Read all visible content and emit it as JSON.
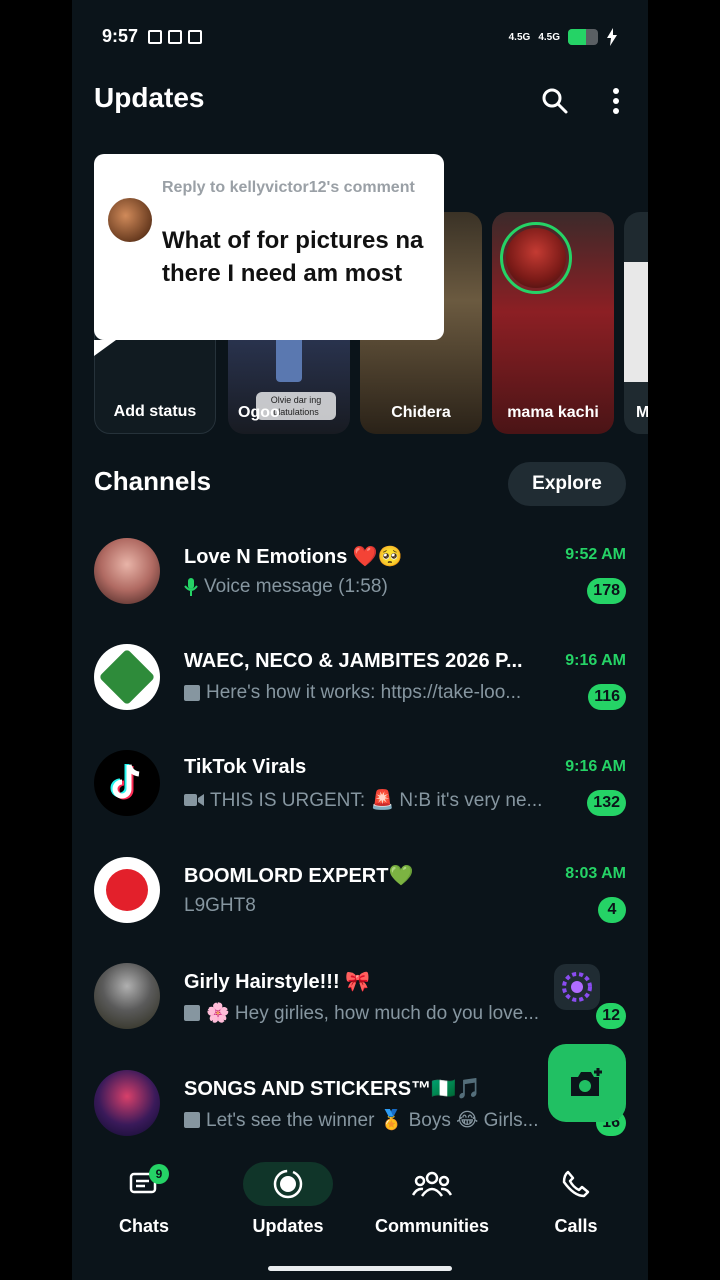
{
  "status_bar": {
    "time": "9:57",
    "network_1": "4.5G",
    "network_2": "4.5G",
    "battery_level": 0.6
  },
  "header": {
    "title": "Updates",
    "search_icon": "search-icon",
    "menu_icon": "more-vert-icon"
  },
  "popup": {
    "subtitle": "Reply to kellyvictor12's comment",
    "text": "What of for pictures na there I need am most"
  },
  "statuses": [
    {
      "label": "Add status"
    },
    {
      "label": "Ogoo",
      "overlay": "Olvie dar ing\nulatulations"
    },
    {
      "label": "Chidera"
    },
    {
      "label": "mama kachi"
    },
    {
      "label": "M"
    }
  ],
  "channels_section": {
    "title": "Channels",
    "explore_label": "Explore"
  },
  "channels": [
    {
      "name": "Love N Emotions ❤️🥺",
      "time": "9:52 AM",
      "preview_icon": "mic-icon",
      "preview": "Voice message (1:58)",
      "unread": "178"
    },
    {
      "name": "WAEC, NECO & JAMBITES 2026 P...",
      "time": "9:16 AM",
      "preview_icon": "image-icon",
      "preview": "Here's how it works: https://take-loo...",
      "unread": "116"
    },
    {
      "name": "TikTok Virals",
      "time": "9:16 AM",
      "preview_icon": "video-icon",
      "preview": "THIS IS URGENT: 🚨 N:B it's very ne...",
      "unread": "132"
    },
    {
      "name": "BOOMLORD EXPERT💚",
      "time": "8:03 AM",
      "preview_icon": "",
      "preview": "L9GHT8",
      "unread": "4"
    },
    {
      "name": "Girly Hairstyle!!! 🎀",
      "time": "",
      "preview_icon": "image-icon",
      "preview": "🌸 Hey girlies, how much do you love...",
      "unread": "12"
    },
    {
      "name": "SONGS AND STICKERS™🇳🇬🎵",
      "time": "",
      "preview_icon": "image-icon",
      "preview": "Let's see the winner 🏅 Boys 😂 Girls...",
      "unread": "16"
    }
  ],
  "nav": [
    {
      "label": "Chats",
      "icon": "chats-icon",
      "badge": "9"
    },
    {
      "label": "Updates",
      "icon": "updates-icon"
    },
    {
      "label": "Communities",
      "icon": "communities-icon"
    },
    {
      "label": "Calls",
      "icon": "calls-icon"
    }
  ],
  "colors": {
    "accent": "#25d366",
    "background": "#0b141a",
    "fab": "#21c063"
  }
}
